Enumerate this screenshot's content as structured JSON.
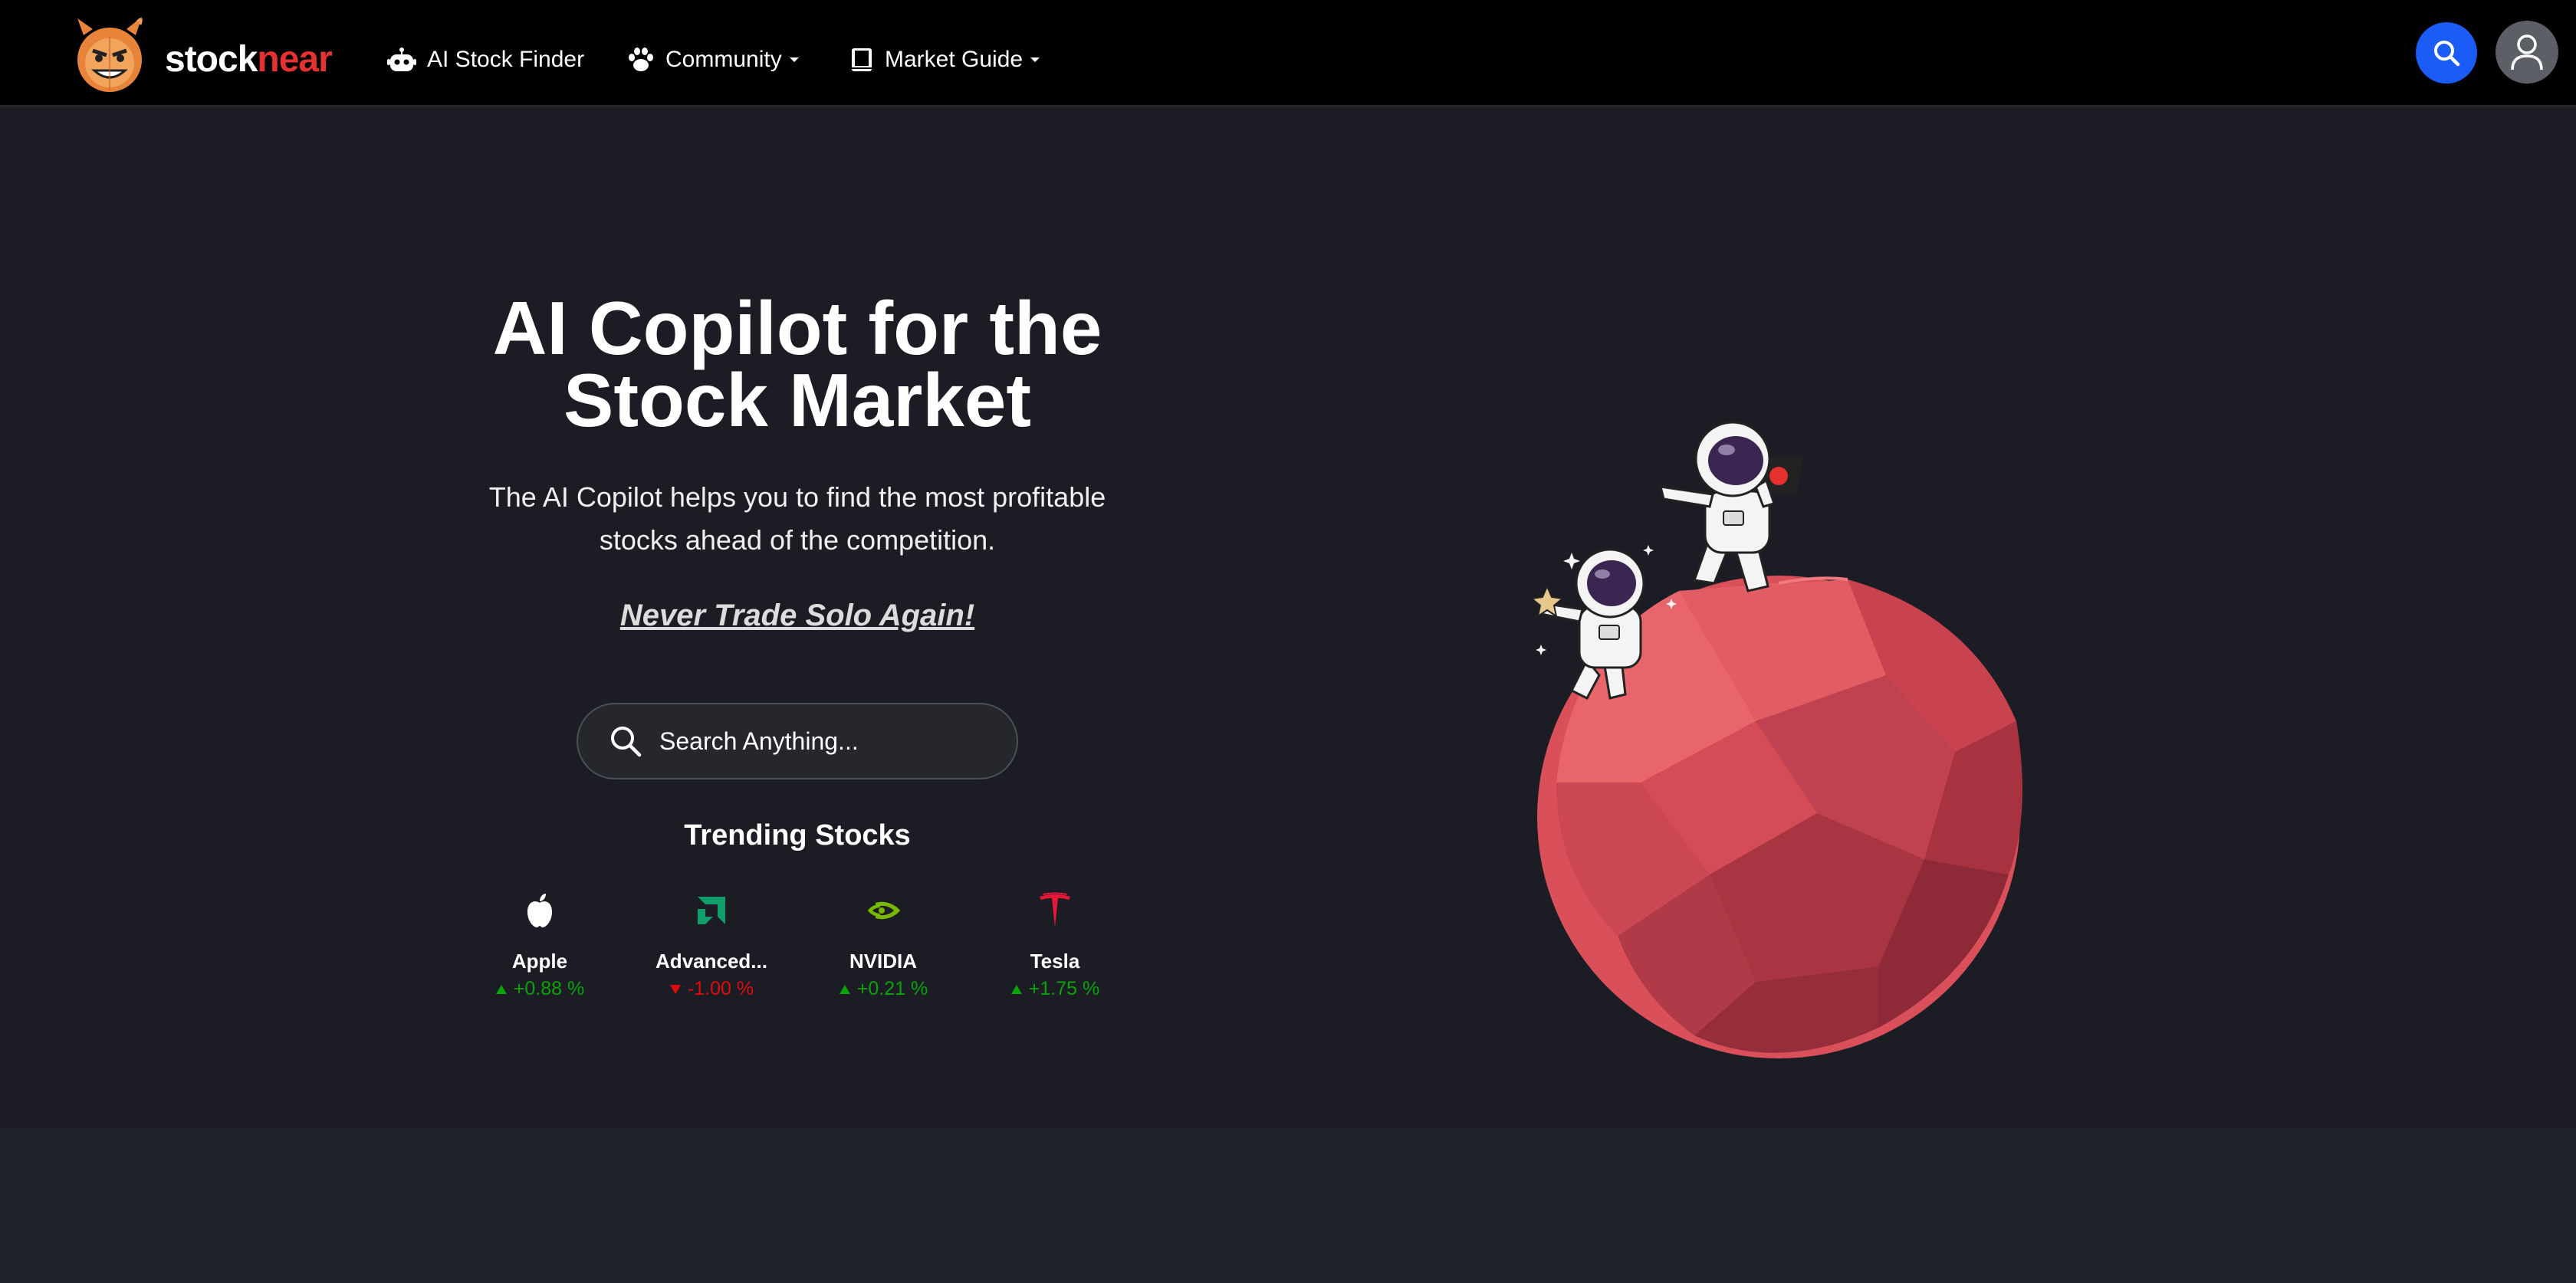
{
  "brand": {
    "name_part1": "stock",
    "name_part2": "near",
    "accent": "#e63131"
  },
  "nav": {
    "items": [
      {
        "label": "AI Stock Finder",
        "icon": "robot-icon"
      },
      {
        "label": "Community",
        "icon": "paw-icon",
        "has_dropdown": true
      },
      {
        "label": "Market Guide",
        "icon": "book-icon",
        "has_dropdown": true
      }
    ],
    "search_button_icon": "search-icon",
    "user_button_icon": "user-icon",
    "search_button_color": "#1a5cf5"
  },
  "hero": {
    "title_line1": "AI Copilot for the",
    "title_line2": "Stock Market",
    "subtitle_line1": "The AI Copilot helps you to find the most profitable",
    "subtitle_line2": "stocks ahead of the competition.",
    "tagline": "Never Trade Solo Again!",
    "search_placeholder": "Search Anything..."
  },
  "trending": {
    "title": "Trending Stocks",
    "stocks": [
      {
        "name": "Apple",
        "change": "+0.88 %",
        "direction": "up",
        "icon": "apple-icon"
      },
      {
        "name": "Advanced...",
        "change": "-1.00 %",
        "direction": "down",
        "icon": "amd-icon"
      },
      {
        "name": "NVIDIA",
        "change": "+0.21 %",
        "direction": "up",
        "icon": "nvidia-icon"
      },
      {
        "name": "Tesla",
        "change": "+1.75 %",
        "direction": "up",
        "icon": "tesla-icon"
      }
    ]
  },
  "colors": {
    "up": "#0aa30a",
    "down": "#e10a0a",
    "hero_bg": "#1c1c25",
    "nav_bg": "#000000"
  }
}
